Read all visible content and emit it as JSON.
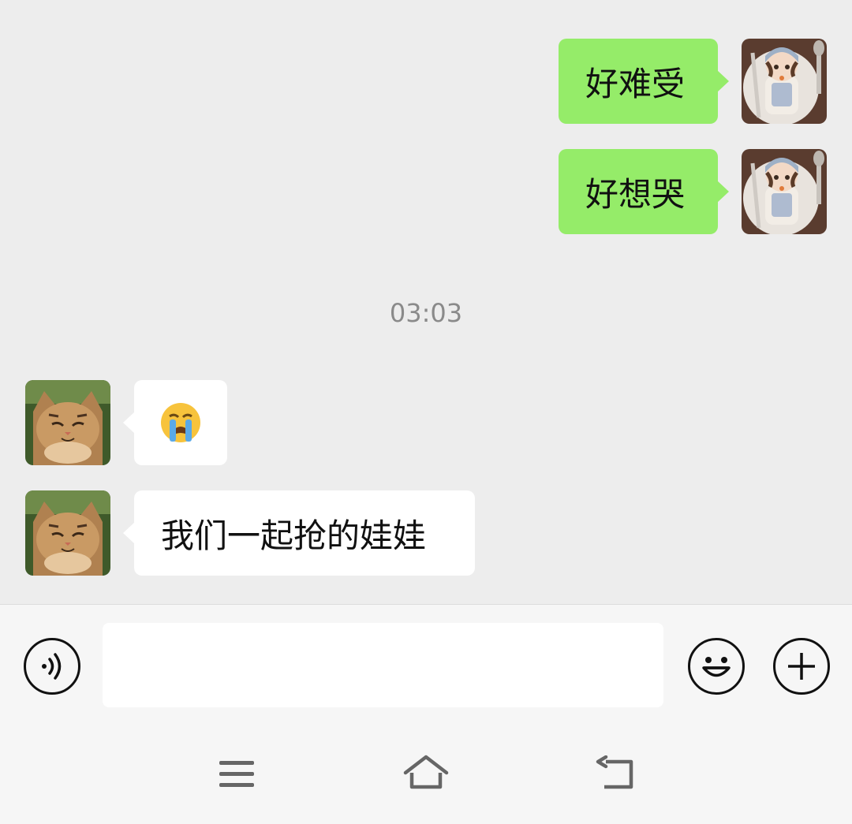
{
  "messages": [
    {
      "direction": "outgoing",
      "text": "好难受",
      "avatar": "doll-figurine-avatar"
    },
    {
      "direction": "outgoing",
      "text": "好想哭",
      "avatar": "doll-figurine-avatar"
    },
    {
      "direction": "incoming",
      "text": "😭",
      "avatar": "tabby-cat-avatar"
    },
    {
      "direction": "incoming",
      "text": "我们一起抢的娃娃",
      "avatar": "tabby-cat-avatar"
    }
  ],
  "timestamp": "03:03",
  "input": {
    "value": "",
    "placeholder": ""
  },
  "icons": {
    "voice": "voice-toggle-icon",
    "emoji": "emoji-icon",
    "more": "plus-icon",
    "menu": "menu-icon",
    "home": "home-icon",
    "back": "back-icon"
  },
  "colors": {
    "background": "#ededed",
    "outgoing_bubble": "#95ec69",
    "incoming_bubble": "#ffffff",
    "timestamp_text": "#8a8a8a"
  }
}
